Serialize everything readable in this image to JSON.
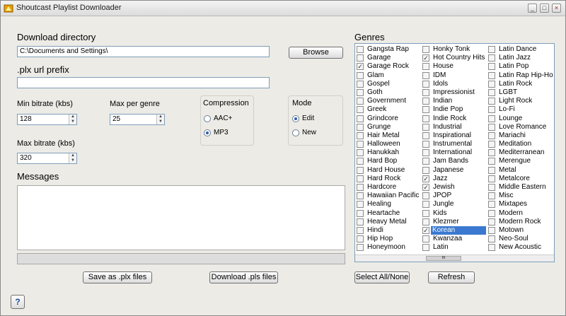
{
  "window": {
    "title": "Shoutcast Playlist Downloader"
  },
  "download_dir": {
    "label": "Download directory",
    "value": "C:\\Documents and Settings\\",
    "browse_label": "Browse"
  },
  "plx_prefix": {
    "label": ".plx url prefix",
    "value": ""
  },
  "min_bitrate": {
    "label": "Min bitrate (kbs)",
    "value": "128"
  },
  "max_per_genre": {
    "label": "Max per genre",
    "value": "25"
  },
  "max_bitrate": {
    "label": "Max bitrate (kbs)",
    "value": "320"
  },
  "compression": {
    "label": "Compression",
    "options": [
      "AAC+",
      "MP3"
    ],
    "selected": "MP3"
  },
  "mode": {
    "label": "Mode",
    "options": [
      "Edit",
      "New"
    ],
    "selected": "Edit"
  },
  "messages": {
    "label": "Messages",
    "content": ""
  },
  "progress": {
    "fraction": 0
  },
  "genres": {
    "label": "Genres",
    "columns": [
      [
        {
          "name": "Gangsta Rap",
          "checked": false
        },
        {
          "name": "Garage",
          "checked": false
        },
        {
          "name": "Garage Rock",
          "checked": true
        },
        {
          "name": "Glam",
          "checked": false
        },
        {
          "name": "Gospel",
          "checked": false
        },
        {
          "name": "Goth",
          "checked": false
        },
        {
          "name": "Government",
          "checked": false
        },
        {
          "name": "Greek",
          "checked": false
        },
        {
          "name": "Grindcore",
          "checked": false
        },
        {
          "name": "Grunge",
          "checked": false
        },
        {
          "name": "Hair Metal",
          "checked": false
        },
        {
          "name": "Halloween",
          "checked": false
        },
        {
          "name": "Hanukkah",
          "checked": false
        },
        {
          "name": "Hard Bop",
          "checked": false
        },
        {
          "name": "Hard House",
          "checked": false
        },
        {
          "name": "Hard Rock",
          "checked": false
        },
        {
          "name": "Hardcore",
          "checked": false
        },
        {
          "name": "Hawaiian Pacific",
          "checked": false
        },
        {
          "name": "Healing",
          "checked": false
        },
        {
          "name": "Heartache",
          "checked": false
        },
        {
          "name": "Heavy Metal",
          "checked": false
        },
        {
          "name": "Hindi",
          "checked": false
        },
        {
          "name": "Hip Hop",
          "checked": false
        },
        {
          "name": "Honeymoon",
          "checked": false
        }
      ],
      [
        {
          "name": "Honky Tonk",
          "checked": false
        },
        {
          "name": "Hot Country Hits",
          "checked": true
        },
        {
          "name": "House",
          "checked": false
        },
        {
          "name": "IDM",
          "checked": false
        },
        {
          "name": "Idols",
          "checked": false
        },
        {
          "name": "Impressionist",
          "checked": false
        },
        {
          "name": "Indian",
          "checked": false
        },
        {
          "name": "Indie Pop",
          "checked": false
        },
        {
          "name": "Indie Rock",
          "checked": false
        },
        {
          "name": "Industrial",
          "checked": false
        },
        {
          "name": "Inspirational",
          "checked": false
        },
        {
          "name": "Instrumental",
          "checked": false
        },
        {
          "name": "International",
          "checked": false
        },
        {
          "name": "Jam Bands",
          "checked": false
        },
        {
          "name": "Japanese",
          "checked": false
        },
        {
          "name": "Jazz",
          "checked": true
        },
        {
          "name": "Jewish",
          "checked": true
        },
        {
          "name": "JPOP",
          "checked": false
        },
        {
          "name": "Jungle",
          "checked": false
        },
        {
          "name": "Kids",
          "checked": false
        },
        {
          "name": "Klezmer",
          "checked": false
        },
        {
          "name": "Korean",
          "checked": true,
          "selected": true
        },
        {
          "name": "Kwanzaa",
          "checked": false
        },
        {
          "name": "Latin",
          "checked": false
        }
      ],
      [
        {
          "name": "Latin Dance",
          "checked": false
        },
        {
          "name": "Latin Jazz",
          "checked": false
        },
        {
          "name": "Latin Pop",
          "checked": false
        },
        {
          "name": "Latin Rap Hip-Ho",
          "checked": false
        },
        {
          "name": "Latin Rock",
          "checked": false
        },
        {
          "name": "LGBT",
          "checked": false
        },
        {
          "name": "Light Rock",
          "checked": false
        },
        {
          "name": "Lo-Fi",
          "checked": false
        },
        {
          "name": "Lounge",
          "checked": false
        },
        {
          "name": "Love Romance",
          "checked": false
        },
        {
          "name": "Mariachi",
          "checked": false
        },
        {
          "name": "Meditation",
          "checked": false
        },
        {
          "name": "Mediterranean",
          "checked": false
        },
        {
          "name": "Merengue",
          "checked": false
        },
        {
          "name": "Metal",
          "checked": false
        },
        {
          "name": "Metalcore",
          "checked": false
        },
        {
          "name": "Middle Eastern",
          "checked": false
        },
        {
          "name": "Misc",
          "checked": false
        },
        {
          "name": "Mixtapes",
          "checked": false
        },
        {
          "name": "Modern",
          "checked": false
        },
        {
          "name": "Modern Rock",
          "checked": false
        },
        {
          "name": "Motown",
          "checked": false
        },
        {
          "name": "Neo-Soul",
          "checked": false
        },
        {
          "name": "New Acoustic",
          "checked": false
        }
      ]
    ]
  },
  "buttons": {
    "save_plx": "Save as .plx files",
    "download_pls": "Download .pls files",
    "select_all": "Select All/None",
    "refresh": "Refresh",
    "help": "?"
  },
  "title_buttons": {
    "minimize": "_",
    "maximize": "□",
    "close": "×"
  },
  "scroll_thumb": "III",
  "check_mark": "✓"
}
